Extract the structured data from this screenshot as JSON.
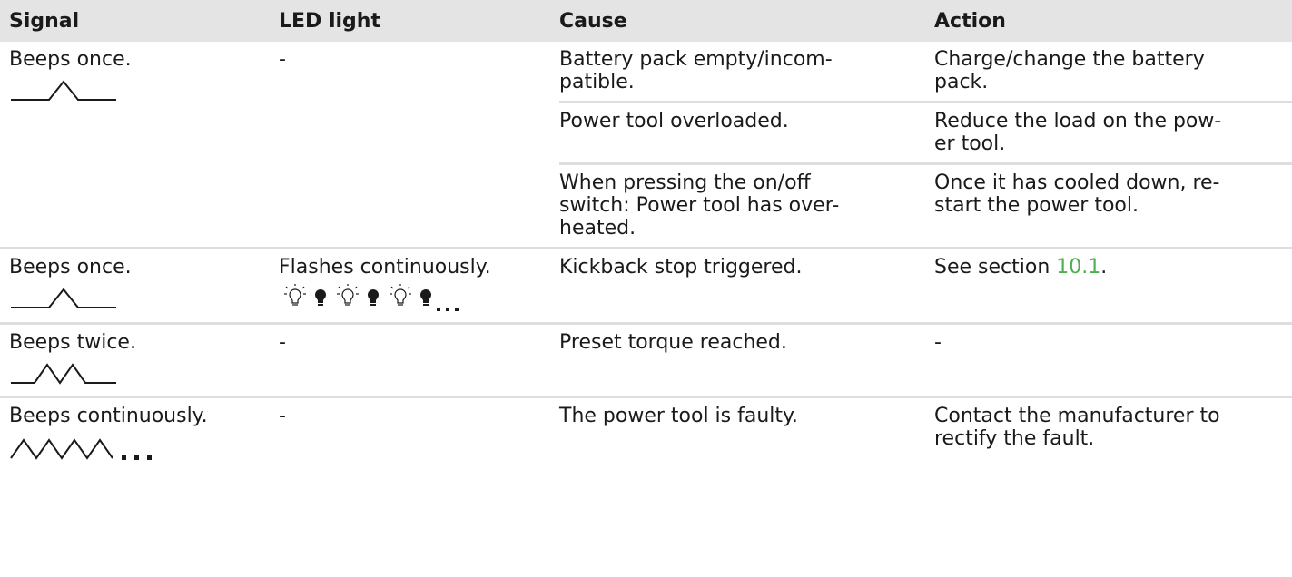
{
  "headers": {
    "signal": "Signal",
    "led": "LED light",
    "cause": "Cause",
    "action": "Action"
  },
  "rows": [
    {
      "signal": "Beeps once.",
      "signal_icon": "single-beep-waveform-icon",
      "led": "-",
      "entries": [
        {
          "cause": "Battery pack empty/incom-\npatible.",
          "action": "Charge/change the battery\npack."
        },
        {
          "cause": "Power tool overloaded.",
          "action": "Reduce the load on the pow-\ner tool."
        },
        {
          "cause": "When pressing the on/off\nswitch: Power tool has over-\nheated.",
          "action": "Once it has cooled down, re-\nstart the power tool."
        }
      ]
    },
    {
      "signal": "Beeps once.",
      "signal_icon": "single-beep-waveform-icon",
      "led": "Flashes continuously.",
      "led_icon": "flashing-led-sequence-icon",
      "entries": [
        {
          "cause": "Kickback stop triggered.",
          "action_prefix": "See section ",
          "action_link": "10.1",
          "action_suffix": "."
        }
      ]
    },
    {
      "signal": "Beeps twice.",
      "signal_icon": "double-beep-waveform-icon",
      "led": "-",
      "entries": [
        {
          "cause": "Preset torque reached.",
          "action": "-"
        }
      ]
    },
    {
      "signal": "Beeps continuously.",
      "signal_icon": "continuous-beep-waveform-icon",
      "led": "-",
      "entries": [
        {
          "cause": "The power tool is faulty.",
          "action": "Contact the manufacturer to\nrectify the fault."
        }
      ]
    }
  ],
  "colors": {
    "header_bg": "#e4e4e4",
    "divider": "#dedede",
    "link": "#4caf50",
    "text": "#1a1a1a"
  }
}
